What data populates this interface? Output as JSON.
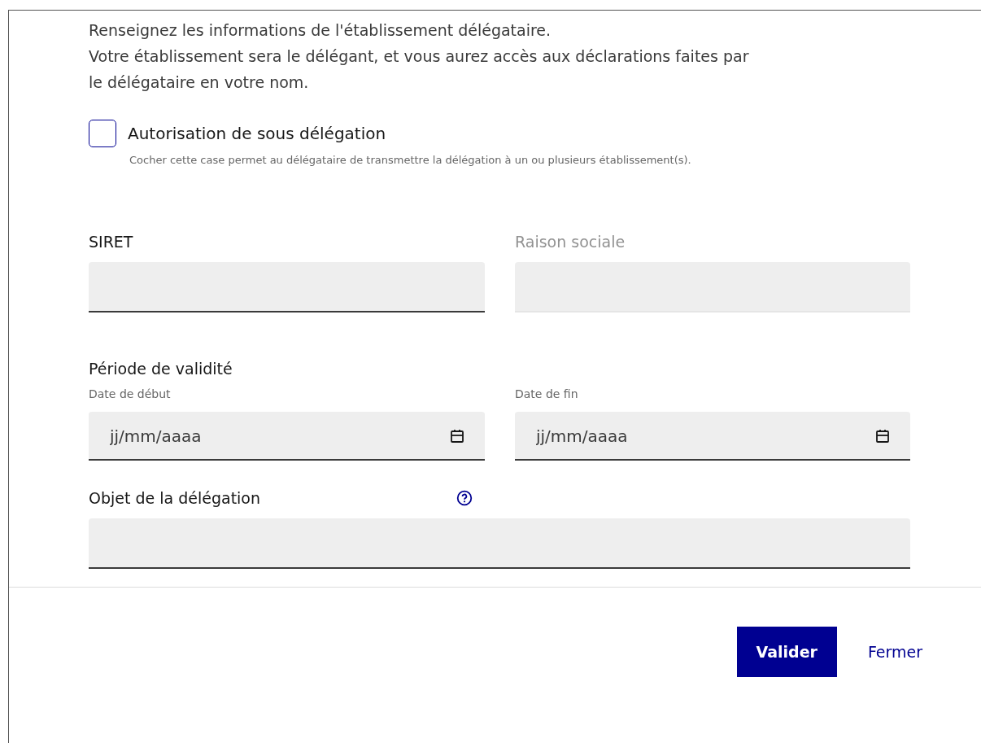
{
  "intro": [
    "Renseignez les informations de l'établissement délégataire.",
    "Votre établissement sera le délégant, et vous aurez accès aux déclarations faites par",
    "le délégataire en votre nom."
  ],
  "checkbox": {
    "label": "Autorisation de sous délégation",
    "hint": "Cocher cette case permet au délégataire de transmettre la délégation à un ou plusieurs établissement(s).",
    "checked": false
  },
  "siret": {
    "label": "SIRET",
    "disabled": false
  },
  "raison_sociale": {
    "label": "Raison sociale",
    "disabled": true
  },
  "periode": {
    "label": "Période de validité",
    "start": {
      "label": "Date de début",
      "placeholder": "jj/mm/aaaa"
    },
    "end": {
      "label": "Date de fin",
      "placeholder": "jj/mm/aaaa"
    }
  },
  "objet": {
    "label": "Objet de la délégation"
  },
  "buttons": [
    {
      "label": "Valider",
      "kind": "primary"
    },
    {
      "label": "Fermer",
      "kind": "tertiary"
    }
  ]
}
